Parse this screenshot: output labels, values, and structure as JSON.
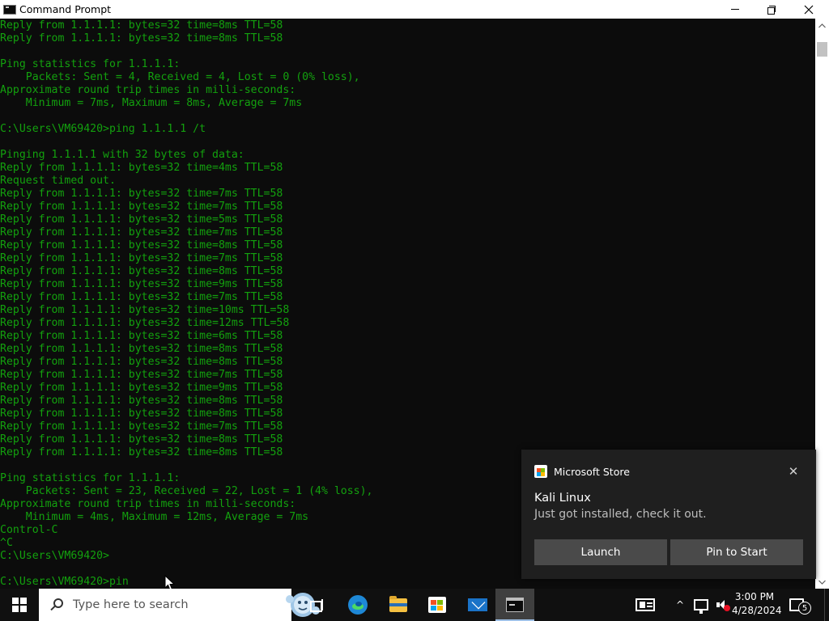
{
  "window": {
    "title": "Command Prompt",
    "icon": "cmd-icon"
  },
  "console": {
    "text_color": "#13a10e",
    "background": "#0c0c0c",
    "lines": [
      "Reply from 1.1.1.1: bytes=32 time=8ms TTL=58",
      "Reply from 1.1.1.1: bytes=32 time=8ms TTL=58",
      "",
      "Ping statistics for 1.1.1.1:",
      "    Packets: Sent = 4, Received = 4, Lost = 0 (0% loss),",
      "Approximate round trip times in milli-seconds:",
      "    Minimum = 7ms, Maximum = 8ms, Average = 7ms",
      "",
      "C:\\Users\\VM69420>ping 1.1.1.1 /t",
      "",
      "Pinging 1.1.1.1 with 32 bytes of data:",
      "Reply from 1.1.1.1: bytes=32 time=4ms TTL=58",
      "Request timed out.",
      "Reply from 1.1.1.1: bytes=32 time=7ms TTL=58",
      "Reply from 1.1.1.1: bytes=32 time=7ms TTL=58",
      "Reply from 1.1.1.1: bytes=32 time=5ms TTL=58",
      "Reply from 1.1.1.1: bytes=32 time=7ms TTL=58",
      "Reply from 1.1.1.1: bytes=32 time=8ms TTL=58",
      "Reply from 1.1.1.1: bytes=32 time=7ms TTL=58",
      "Reply from 1.1.1.1: bytes=32 time=8ms TTL=58",
      "Reply from 1.1.1.1: bytes=32 time=9ms TTL=58",
      "Reply from 1.1.1.1: bytes=32 time=7ms TTL=58",
      "Reply from 1.1.1.1: bytes=32 time=10ms TTL=58",
      "Reply from 1.1.1.1: bytes=32 time=12ms TTL=58",
      "Reply from 1.1.1.1: bytes=32 time=6ms TTL=58",
      "Reply from 1.1.1.1: bytes=32 time=8ms TTL=58",
      "Reply from 1.1.1.1: bytes=32 time=8ms TTL=58",
      "Reply from 1.1.1.1: bytes=32 time=7ms TTL=58",
      "Reply from 1.1.1.1: bytes=32 time=9ms TTL=58",
      "Reply from 1.1.1.1: bytes=32 time=8ms TTL=58",
      "Reply from 1.1.1.1: bytes=32 time=8ms TTL=58",
      "Reply from 1.1.1.1: bytes=32 time=7ms TTL=58",
      "Reply from 1.1.1.1: bytes=32 time=8ms TTL=58",
      "Reply from 1.1.1.1: bytes=32 time=8ms TTL=58",
      "",
      "Ping statistics for 1.1.1.1:",
      "    Packets: Sent = 23, Received = 22, Lost = 1 (4% loss),",
      "Approximate round trip times in milli-seconds:",
      "    Minimum = 4ms, Maximum = 12ms, Average = 7ms",
      "Control-C",
      "^C",
      "C:\\Users\\VM69420>",
      "",
      "C:\\Users\\VM69420>pin"
    ]
  },
  "toast": {
    "app_name": "Microsoft Store",
    "close_glyph": "✕",
    "title": "Kali Linux",
    "body": "Just got installed, check it out.",
    "buttons": {
      "launch": "Launch",
      "pin": "Pin to Start"
    }
  },
  "taskbar": {
    "search_placeholder": "Type here to search",
    "apps": [
      "start-icon",
      "task-view-icon",
      "edge-icon",
      "file-explorer-icon",
      "microsoft-store-icon",
      "mail-icon",
      "command-prompt-icon"
    ],
    "tray": {
      "chevron": "^",
      "time": "3:00 PM",
      "date": "4/28/2024",
      "notification_count": "5"
    }
  }
}
